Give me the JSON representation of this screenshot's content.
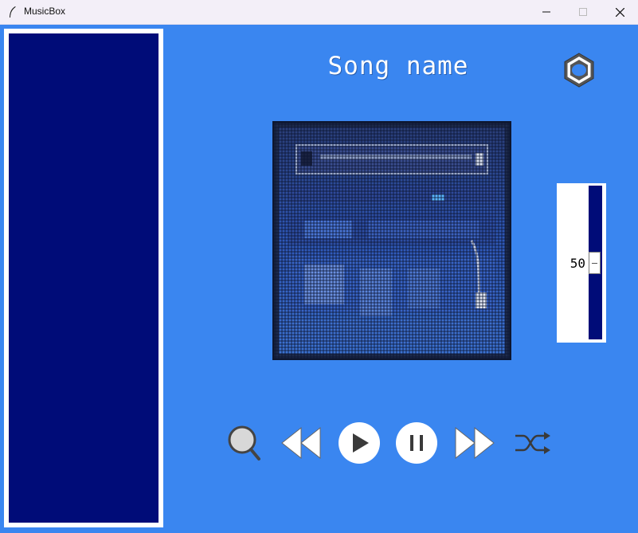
{
  "window": {
    "title": "MusicBox",
    "icons": {
      "app": "feather-icon",
      "minimize": "minimize-icon",
      "maximize": "maximize-icon",
      "close": "close-icon"
    }
  },
  "header": {
    "song_title": "Song name"
  },
  "settings": {
    "icon": "gear-hex-icon"
  },
  "album_art": {
    "icon": "album-cover-image"
  },
  "volume": {
    "value": "50",
    "level": 0.5
  },
  "controls": {
    "search": "search-icon",
    "previous": "rewind-icon",
    "play": "play-icon",
    "pause": "pause-icon",
    "next": "fast-forward-icon",
    "shuffle": "shuffle-icon"
  },
  "colors": {
    "background": "#3a86f0",
    "panel_dark": "#000c78",
    "panel_border": "#ffffff",
    "titlebar": "#f3eff8"
  }
}
